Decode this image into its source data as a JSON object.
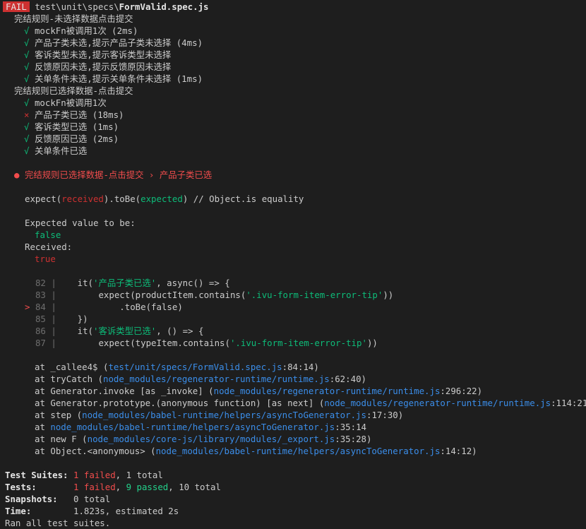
{
  "header": {
    "badge": "FAIL",
    "path_prefix": "test\\unit\\specs\\",
    "file": "FormValid.spec.js"
  },
  "suites": [
    {
      "title": "完结规则-未选择数据点击提交",
      "tests": [
        {
          "mark": "√",
          "name": "mockFn被调用1次",
          "time": " (2ms)",
          "status": "pass"
        },
        {
          "mark": "√",
          "name": "产品子类未选,提示产品子类未选择",
          "time": " (4ms)",
          "status": "pass"
        },
        {
          "mark": "√",
          "name": "客诉类型未选,提示客诉类型未选择",
          "time": "",
          "status": "pass"
        },
        {
          "mark": "√",
          "name": "反馈原因未选,提示反馈原因未选择",
          "time": "",
          "status": "pass"
        },
        {
          "mark": "√",
          "name": "关单条件未选,提示关单条件未选择",
          "time": " (1ms)",
          "status": "pass"
        }
      ]
    },
    {
      "title": "完结规则已选择数据-点击提交",
      "tests": [
        {
          "mark": "√",
          "name": "mockFn被调用1次",
          "time": "",
          "status": "pass"
        },
        {
          "mark": "×",
          "name": "产品子类已选",
          "time": " (18ms)",
          "status": "fail"
        },
        {
          "mark": "√",
          "name": "客诉类型已选",
          "time": " (1ms)",
          "status": "pass"
        },
        {
          "mark": "√",
          "name": "反馈原因已选",
          "time": " (2ms)",
          "status": "pass"
        },
        {
          "mark": "√",
          "name": "关单条件已选",
          "time": "",
          "status": "pass"
        }
      ]
    }
  ],
  "failure": {
    "bullet": "●",
    "title": "完结规则已选择数据-点击提交 › 产品子类已选",
    "expect_pre": "expect(",
    "received_word": "received",
    "expect_mid": ").toBe(",
    "expected_word": "expected",
    "expect_post": ") // Object.is equality",
    "expected_label": "Expected value to be:",
    "expected_value": "false",
    "received_label": "Received:",
    "received_value": "true"
  },
  "code_lines": [
    {
      "marker": " ",
      "num": "82",
      "gutter": " |",
      "a": "    it(",
      "s": "'产品子类已选'",
      "b": ", async() => {"
    },
    {
      "marker": " ",
      "num": "83",
      "gutter": " |",
      "a": "        expect(productItem.contains(",
      "s": "'.ivu-form-item-error-tip'",
      "b": "))"
    },
    {
      "marker": ">",
      "num": "84",
      "gutter": " |",
      "a": "            .toBe(false)",
      "s": "",
      "b": ""
    },
    {
      "marker": " ",
      "num": "85",
      "gutter": " |",
      "a": "    })",
      "s": "",
      "b": ""
    },
    {
      "marker": " ",
      "num": "86",
      "gutter": " |",
      "a": "    it(",
      "s": "'客诉类型已选'",
      "b": ", () => {"
    },
    {
      "marker": " ",
      "num": "87",
      "gutter": " |",
      "a": "        expect(typeItem.contains(",
      "s": "'.ivu-form-item-error-tip'",
      "b": "))"
    }
  ],
  "stack": [
    {
      "pre": "at _callee4$ (",
      "link": "test/unit/specs/FormValid.spec.js",
      "loc": ":84:14)"
    },
    {
      "pre": "at tryCatch (",
      "link": "node_modules/regenerator-runtime/runtime.js",
      "loc": ":62:40)"
    },
    {
      "pre": "at Generator.invoke [as _invoke] (",
      "link": "node_modules/regenerator-runtime/runtime.js",
      "loc": ":296:22)"
    },
    {
      "pre": "at Generator.prototype.(anonymous function) [as next] (",
      "link": "node_modules/regenerator-runtime/runtime.js",
      "loc": ":114:21)"
    },
    {
      "pre": "at step (",
      "link": "node_modules/babel-runtime/helpers/asyncToGenerator.js",
      "loc": ":17:30)"
    },
    {
      "pre": "at ",
      "link": "node_modules/babel-runtime/helpers/asyncToGenerator.js",
      "loc": ":35:14"
    },
    {
      "pre": "at new F (",
      "link": "node_modules/core-js/library/modules/_export.js",
      "loc": ":35:28)"
    },
    {
      "pre": "at Object.<anonymous> (",
      "link": "node_modules/babel-runtime/helpers/asyncToGenerator.js",
      "loc": ":14:12)"
    }
  ],
  "summary": {
    "suites_label": "Test Suites: ",
    "suites_failed": "1 failed",
    "suites_total": ", 1 total",
    "tests_label": "Tests:       ",
    "tests_failed": "1 failed",
    "tests_sep": ", ",
    "tests_passed": "9 passed",
    "tests_total": ", 10 total",
    "snapshots_label": "Snapshots:   ",
    "snapshots_value": "0 total",
    "time_label": "Time:        ",
    "time_value": "1.823s, estimated 2s",
    "footer": "Ran all test suites."
  }
}
